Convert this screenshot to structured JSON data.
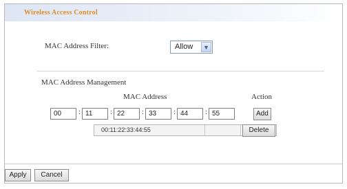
{
  "title": "Wireless Access Control",
  "filter": {
    "label": "MAC Address Filter:",
    "selected": "Allow",
    "arrow_icon": "chevron-down-icon"
  },
  "management": {
    "heading": "MAC Address Management",
    "column_mac": "MAC Address",
    "column_action": "Action",
    "inputs": [
      "00",
      "11",
      "22",
      "33",
      "44",
      "55"
    ],
    "separator": ":",
    "add_label": "Add",
    "entries": [
      {
        "mac": "00:11:22:33:44:55",
        "delete_label": "Delete"
      }
    ]
  },
  "footer": {
    "apply_label": "Apply",
    "cancel_label": "Cancel"
  }
}
